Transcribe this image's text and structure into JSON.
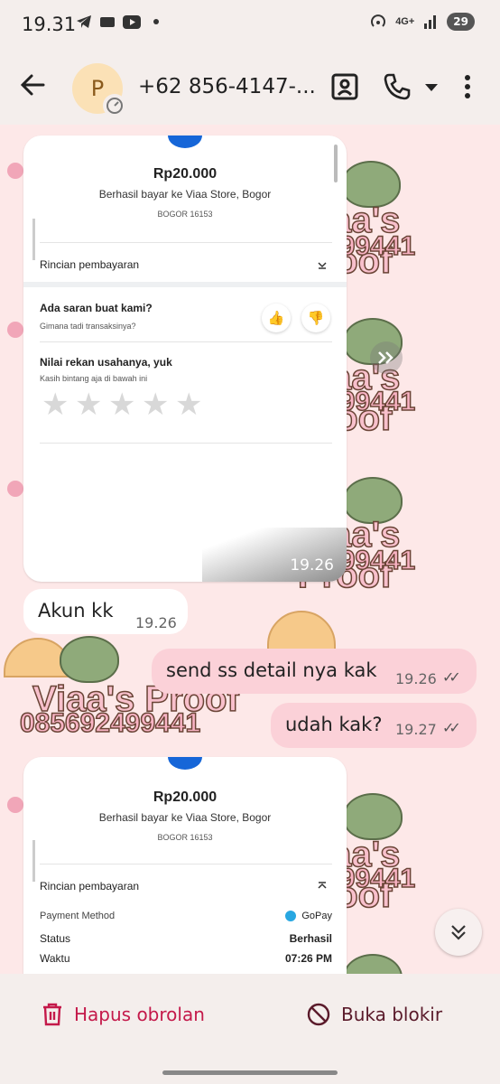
{
  "status_bar": {
    "time": "19.31",
    "network": "4G+",
    "battery": "29"
  },
  "header": {
    "avatar_letter": "P",
    "contact": "+62 856-4147-..."
  },
  "watermark": {
    "title": "Viaa's Proof",
    "number": "085692499441"
  },
  "receipt1": {
    "amount": "Rp20.000",
    "merchant": "Berhasil bayar ke Viaa Store, Bogor",
    "postal": "BOGOR 16153",
    "details_label": "Rincian pembayaran",
    "feedback_title": "Ada saran buat kami?",
    "feedback_sub": "Gimana tadi transaksinya?",
    "rate_title": "Nilai rekan usahanya, yuk",
    "rate_sub": "Kasih bintang aja di bawah ini",
    "time": "19.26"
  },
  "messages": [
    {
      "text": "Akun kk",
      "time": "19.26"
    },
    {
      "text": "send ss detail nya kak",
      "time": "19.26"
    },
    {
      "text": "udah kak?",
      "time": "19.27"
    }
  ],
  "receipt2": {
    "amount": "Rp20.000",
    "merchant": "Berhasil bayar ke Viaa Store, Bogor",
    "postal": "BOGOR 16153",
    "details_label": "Rincian pembayaran",
    "rows": [
      {
        "label": "Payment Method",
        "value": "GoPay"
      },
      {
        "label": "Status",
        "value": "Berhasil"
      },
      {
        "label": "Waktu",
        "value": "07:26 PM"
      }
    ]
  },
  "bottom": {
    "delete_label": "Hapus obrolan",
    "unblock_label": "Buka blokir"
  },
  "colors": {
    "accent": "#c4194a",
    "outgoing": "#fbd1d8",
    "chat_bg": "#fde8e8"
  }
}
